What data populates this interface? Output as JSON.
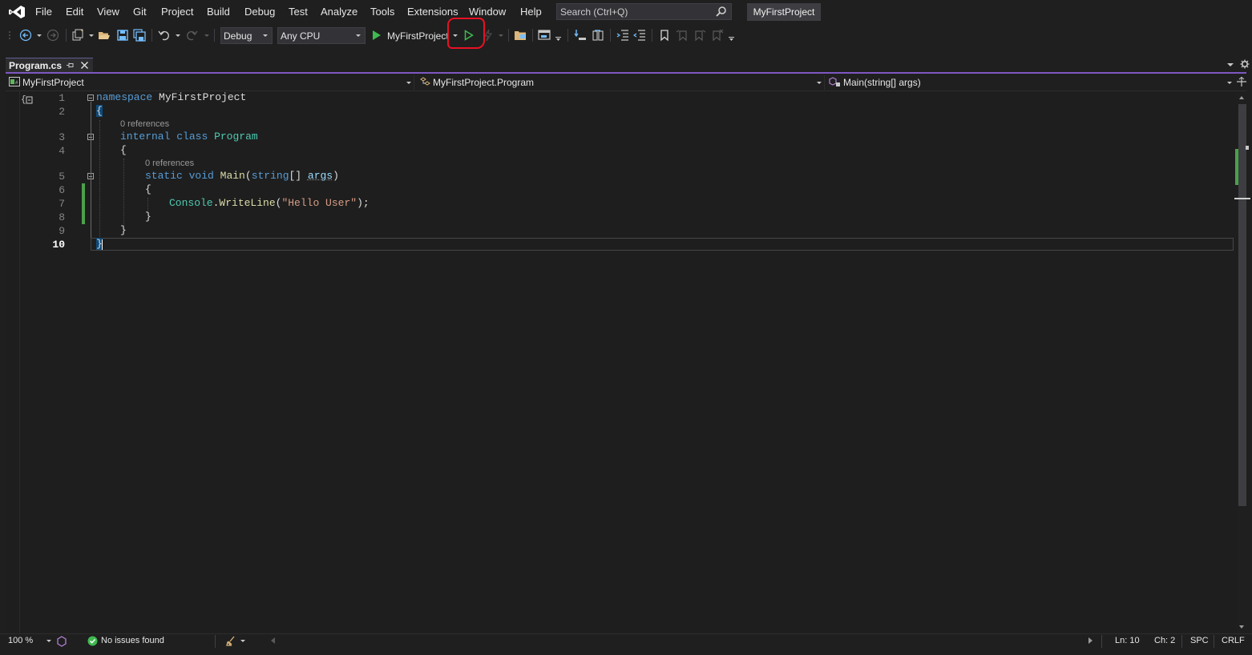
{
  "menubar": {
    "items": [
      "File",
      "Edit",
      "View",
      "Git",
      "Project",
      "Build",
      "Debug",
      "Test",
      "Analyze",
      "Tools",
      "Extensions",
      "Window",
      "Help"
    ],
    "search_placeholder": "Search (Ctrl+Q)",
    "project_badge": "MyFirstProject"
  },
  "toolbar": {
    "config": "Debug",
    "platform": "Any CPU",
    "start_label": "MyFirstProject"
  },
  "tab": {
    "label": "Program.cs"
  },
  "navbar": {
    "project": "MyFirstProject",
    "type": "MyFirstProject.Program",
    "member": "Main(string[] args)"
  },
  "editor": {
    "line_numbers": [
      "1",
      "2",
      "3",
      "4",
      "5",
      "6",
      "7",
      "8",
      "9",
      "10"
    ],
    "refs": [
      "0 references",
      "0 references"
    ],
    "code": {
      "l1_kw": "namespace",
      "l1_name": "MyFirstProject",
      "brace_open": "{",
      "brace_close": "}",
      "l3_mod": "internal",
      "l3_kw": "class",
      "l3_name": "Program",
      "l5_static": "static",
      "l5_void": "void",
      "l5_main": "Main",
      "l5_paren": "(",
      "l5_string": "string",
      "l5_arr": "[] ",
      "l5_args": "args",
      "l5_close": ")",
      "l7_console": "Console",
      "l7_dot": ".",
      "l7_write": "WriteLine",
      "l7_open": "(",
      "l7_str": "\"Hello User\"",
      "l7_end": ");"
    }
  },
  "status": {
    "zoom": "100 %",
    "issues": "No issues found",
    "line": "Ln: 10",
    "col": "Ch: 2",
    "spacing": "SPC",
    "eol": "CRLF"
  },
  "colors": {
    "accent": "#7e57c2",
    "keyword": "#569cd6",
    "type": "#4ec9b0",
    "method": "#dcdcaa",
    "string": "#d69d85",
    "highlight": "#e81123",
    "run": "#3fb950"
  }
}
